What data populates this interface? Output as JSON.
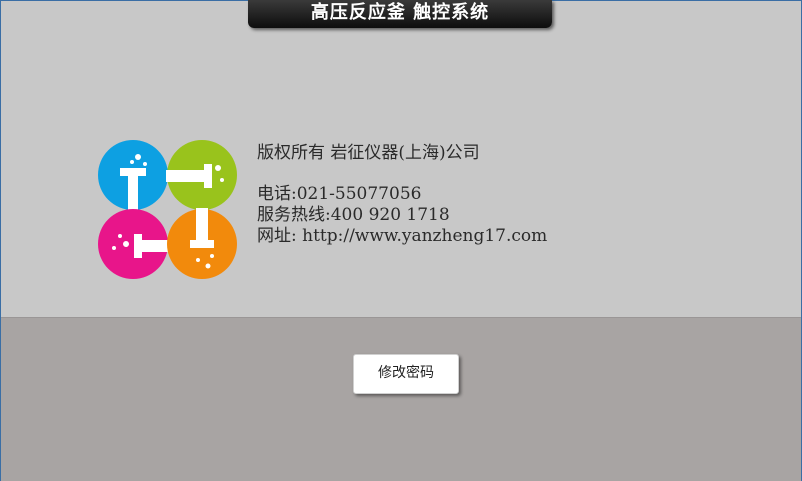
{
  "header": {
    "title": "高压反应釜 触控系统"
  },
  "company": {
    "copyright": "版权所有 岩征仪器(上海)公司",
    "phone": "电话:021-55077056",
    "hotline": "服务热线:400 920 1718",
    "website": "网址: http://www.yanzheng17.com"
  },
  "actions": {
    "change_password": "修改密码"
  },
  "colors": {
    "logo_blue": "#0da0e2",
    "logo_green": "#99c31c",
    "logo_pink": "#e8158a",
    "logo_orange": "#f28a0c",
    "top_panel": "#c8c8c8",
    "bottom_panel": "#a8a4a3"
  }
}
